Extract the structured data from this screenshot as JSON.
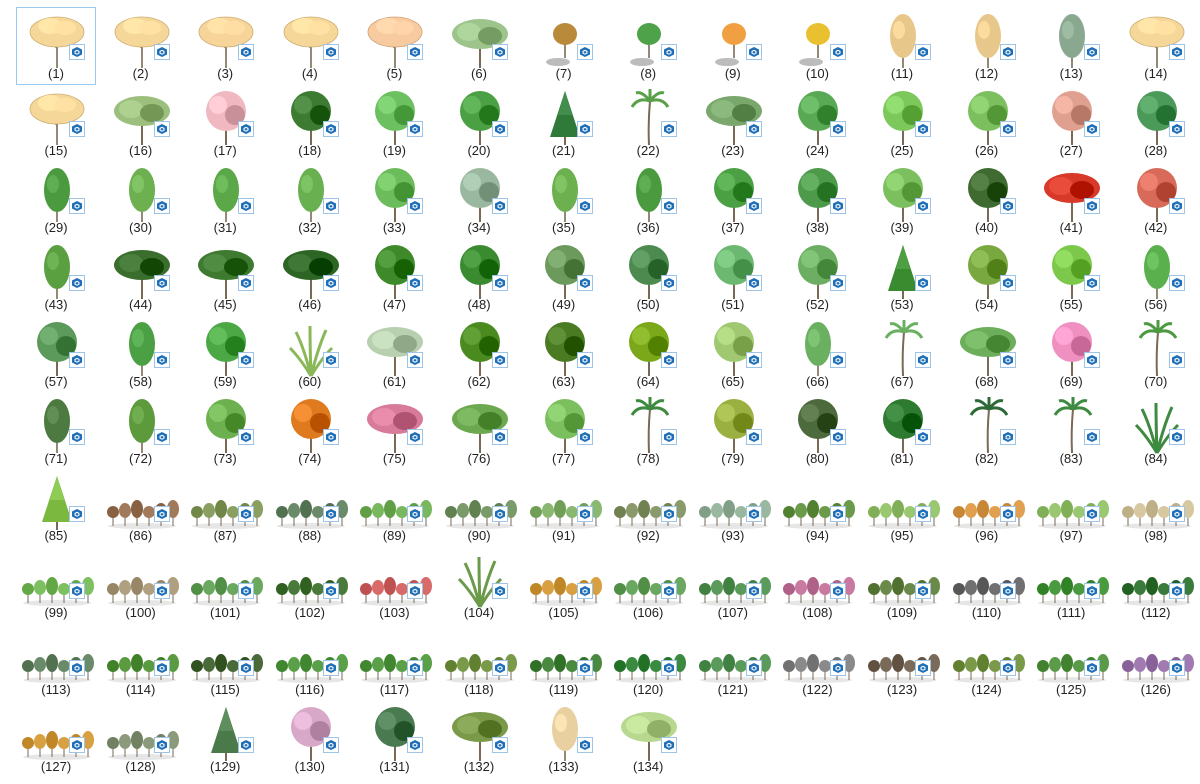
{
  "files": [
    {
      "label": "(1)",
      "icon": "tree-sketch",
      "color": "#f5d79a"
    },
    {
      "label": "(2)",
      "icon": "tree-sketch",
      "color": "#f5d79a"
    },
    {
      "label": "(3)",
      "icon": "tree-sketch",
      "color": "#f6d49a"
    },
    {
      "label": "(4)",
      "icon": "tree-sketch",
      "color": "#f5d79a"
    },
    {
      "label": "(5)",
      "icon": "tree-sketch",
      "color": "#f8caa0"
    },
    {
      "label": "(6)",
      "icon": "tree-broad",
      "color": "#9dc48a"
    },
    {
      "label": "(7)",
      "icon": "tree-small",
      "color": "#b88a3a"
    },
    {
      "label": "(8)",
      "icon": "tree-small",
      "color": "#4ea34a"
    },
    {
      "label": "(9)",
      "icon": "tree-small",
      "color": "#f0a040"
    },
    {
      "label": "(10)",
      "icon": "tree-small",
      "color": "#e8c030"
    },
    {
      "label": "(11)",
      "icon": "tree-tall",
      "color": "#e8c88a"
    },
    {
      "label": "(12)",
      "icon": "tree-tall",
      "color": "#e8c88a"
    },
    {
      "label": "(13)",
      "icon": "tree-tall",
      "color": "#8aa890"
    },
    {
      "label": "(14)",
      "icon": "tree-sketch",
      "color": "#f5d79a"
    },
    {
      "label": "(15)",
      "icon": "tree-sketch",
      "color": "#f5d79a"
    },
    {
      "label": "(16)",
      "icon": "tree-broad",
      "color": "#9cbf7e"
    },
    {
      "label": "(17)",
      "icon": "tree-round",
      "color": "#f0b8c0"
    },
    {
      "label": "(18)",
      "icon": "tree-round",
      "color": "#3d7a32"
    },
    {
      "label": "(19)",
      "icon": "tree-round",
      "color": "#6cc060"
    },
    {
      "label": "(20)",
      "icon": "tree-round",
      "color": "#4ca044"
    },
    {
      "label": "(21)",
      "icon": "tree-conifer",
      "color": "#2f7a38"
    },
    {
      "label": "(22)",
      "icon": "tree-palm",
      "color": "#5aa048"
    },
    {
      "label": "(23)",
      "icon": "tree-broad",
      "color": "#7aa86c"
    },
    {
      "label": "(24)",
      "icon": "tree-round",
      "color": "#58a854"
    },
    {
      "label": "(25)",
      "icon": "tree-round",
      "color": "#7cc85a"
    },
    {
      "label": "(26)",
      "icon": "tree-round",
      "color": "#7cbf5e"
    },
    {
      "label": "(27)",
      "icon": "tree-round",
      "color": "#e0a090"
    },
    {
      "label": "(28)",
      "icon": "tree-round",
      "color": "#4c9a5a"
    },
    {
      "label": "(29)",
      "icon": "tree-tall",
      "color": "#4c9a40"
    },
    {
      "label": "(30)",
      "icon": "tree-tall",
      "color": "#6cb050"
    },
    {
      "label": "(31)",
      "icon": "tree-tall",
      "color": "#5aa848"
    },
    {
      "label": "(32)",
      "icon": "tree-tall",
      "color": "#68b050"
    },
    {
      "label": "(33)",
      "icon": "tree-round",
      "color": "#6cbc5c"
    },
    {
      "label": "(34)",
      "icon": "tree-round",
      "color": "#9ab8a0"
    },
    {
      "label": "(35)",
      "icon": "tree-tall",
      "color": "#6cb050"
    },
    {
      "label": "(36)",
      "icon": "tree-tall",
      "color": "#4c9a40"
    },
    {
      "label": "(37)",
      "icon": "tree-round",
      "color": "#4ca044"
    },
    {
      "label": "(38)",
      "icon": "tree-round",
      "color": "#4c9a4a"
    },
    {
      "label": "(39)",
      "icon": "tree-round",
      "color": "#7cbf5e"
    },
    {
      "label": "(40)",
      "icon": "tree-round",
      "color": "#3f6a30"
    },
    {
      "label": "(41)",
      "icon": "tree-broad",
      "color": "#d83a2a"
    },
    {
      "label": "(42)",
      "icon": "tree-round",
      "color": "#d86a5a"
    },
    {
      "label": "(43)",
      "icon": "tree-tall",
      "color": "#5aa040"
    },
    {
      "label": "(44)",
      "icon": "tree-broad",
      "color": "#3a6e2c"
    },
    {
      "label": "(45)",
      "icon": "tree-broad",
      "color": "#3e7a30"
    },
    {
      "label": "(46)",
      "icon": "tree-broad",
      "color": "#2d6624"
    },
    {
      "label": "(47)",
      "icon": "tree-round",
      "color": "#3e8a2a"
    },
    {
      "label": "(48)",
      "icon": "tree-round",
      "color": "#3a8a30"
    },
    {
      "label": "(49)",
      "icon": "tree-round",
      "color": "#6c9a5c"
    },
    {
      "label": "(50)",
      "icon": "tree-round",
      "color": "#4c8a50"
    },
    {
      "label": "(51)",
      "icon": "tree-round",
      "color": "#6cb870"
    },
    {
      "label": "(52)",
      "icon": "tree-round",
      "color": "#6cae62"
    },
    {
      "label": "(53)",
      "icon": "tree-conifer",
      "color": "#3a8a30"
    },
    {
      "label": "(54)",
      "icon": "tree-round",
      "color": "#7aa840"
    },
    {
      "label": "(55)",
      "icon": "tree-round",
      "color": "#7cc84a"
    },
    {
      "label": "(56)",
      "icon": "tree-tall",
      "color": "#5ab04c"
    },
    {
      "label": "(57)",
      "icon": "tree-round",
      "color": "#5c9a5c"
    },
    {
      "label": "(58)",
      "icon": "tree-tall",
      "color": "#4ca044"
    },
    {
      "label": "(59)",
      "icon": "tree-round",
      "color": "#4ca844"
    },
    {
      "label": "(60)",
      "icon": "tree-grass",
      "color": "#8ab858"
    },
    {
      "label": "(61)",
      "icon": "tree-broad",
      "color": "#b8d0b0"
    },
    {
      "label": "(62)",
      "icon": "tree-round",
      "color": "#4a8a1e"
    },
    {
      "label": "(63)",
      "icon": "tree-round",
      "color": "#4a7a22"
    },
    {
      "label": "(64)",
      "icon": "tree-round",
      "color": "#7aa818"
    },
    {
      "label": "(65)",
      "icon": "tree-round",
      "color": "#a0c870"
    },
    {
      "label": "(66)",
      "icon": "tree-tall",
      "color": "#6ab060"
    },
    {
      "label": "(67)",
      "icon": "tree-palm",
      "color": "#6ab060"
    },
    {
      "label": "(68)",
      "icon": "tree-broad",
      "color": "#6cae5a"
    },
    {
      "label": "(69)",
      "icon": "tree-round",
      "color": "#f090c0"
    },
    {
      "label": "(70)",
      "icon": "tree-palm",
      "color": "#4c9a40"
    },
    {
      "label": "(71)",
      "icon": "tree-tall",
      "color": "#4c7a40"
    },
    {
      "label": "(72)",
      "icon": "tree-tall",
      "color": "#5c9a3c"
    },
    {
      "label": "(73)",
      "icon": "tree-round",
      "color": "#6cb050"
    },
    {
      "label": "(74)",
      "icon": "tree-round",
      "color": "#e07a1e"
    },
    {
      "label": "(75)",
      "icon": "tree-broad",
      "color": "#d87a9a"
    },
    {
      "label": "(76)",
      "icon": "tree-broad",
      "color": "#6ca850"
    },
    {
      "label": "(77)",
      "icon": "tree-round",
      "color": "#7cbf5e"
    },
    {
      "label": "(78)",
      "icon": "tree-palm",
      "color": "#3e8a40"
    },
    {
      "label": "(79)",
      "icon": "tree-round",
      "color": "#9ab040"
    },
    {
      "label": "(80)",
      "icon": "tree-round",
      "color": "#4c6a3c"
    },
    {
      "label": "(81)",
      "icon": "tree-round",
      "color": "#2e7a30"
    },
    {
      "label": "(82)",
      "icon": "tree-palm",
      "color": "#2e6a38"
    },
    {
      "label": "(83)",
      "icon": "tree-palm",
      "color": "#3e8a40"
    },
    {
      "label": "(84)",
      "icon": "tree-grass",
      "color": "#3e8a40"
    },
    {
      "label": "(85)",
      "icon": "tree-conifer",
      "color": "#7ab840"
    },
    {
      "label": "(86)",
      "icon": "tree-row",
      "color": "#a07a5a"
    },
    {
      "label": "(87)",
      "icon": "tree-row",
      "color": "#8aa060"
    },
    {
      "label": "(88)",
      "icon": "tree-row",
      "color": "#6a8a6a"
    },
    {
      "label": "(89)",
      "icon": "tree-row",
      "color": "#7ab860"
    },
    {
      "label": "(90)",
      "icon": "tree-row",
      "color": "#7a9a6a"
    },
    {
      "label": "(91)",
      "icon": "tree-row",
      "color": "#8ab870"
    },
    {
      "label": "(92)",
      "icon": "tree-row",
      "color": "#8a9a6a"
    },
    {
      "label": "(93)",
      "icon": "tree-row",
      "color": "#9ab8a0"
    },
    {
      "label": "(94)",
      "icon": "tree-row",
      "color": "#6a9a4a"
    },
    {
      "label": "(95)",
      "icon": "tree-row",
      "color": "#9ac870"
    },
    {
      "label": "(96)",
      "icon": "tree-row",
      "color": "#e0a050"
    },
    {
      "label": "(97)",
      "icon": "tree-row",
      "color": "#9ac870"
    },
    {
      "label": "(98)",
      "icon": "tree-row",
      "color": "#d8c8a0"
    },
    {
      "label": "(99)",
      "icon": "tree-row",
      "color": "#7cc060"
    },
    {
      "label": "(100)",
      "icon": "tree-row",
      "color": "#b0a080"
    },
    {
      "label": "(101)",
      "icon": "tree-row",
      "color": "#6aa860"
    },
    {
      "label": "(102)",
      "icon": "tree-row",
      "color": "#4a7a3a"
    },
    {
      "label": "(103)",
      "icon": "tree-row",
      "color": "#d86a6a"
    },
    {
      "label": "(104)",
      "icon": "tree-grass",
      "color": "#6a9a4a"
    },
    {
      "label": "(105)",
      "icon": "tree-row",
      "color": "#d8a040"
    },
    {
      "label": "(106)",
      "icon": "tree-row",
      "color": "#6aa860"
    },
    {
      "label": "(107)",
      "icon": "tree-row",
      "color": "#5a9a5a"
    },
    {
      "label": "(108)",
      "icon": "tree-row",
      "color": "#c87aa0"
    },
    {
      "label": "(109)",
      "icon": "tree-row",
      "color": "#6a8a4a"
    },
    {
      "label": "(110)",
      "icon": "tree-row",
      "color": "#707070"
    },
    {
      "label": "(111)",
      "icon": "tree-row",
      "color": "#4a9a40"
    },
    {
      "label": "(112)",
      "icon": "tree-row",
      "color": "#3a7a3a"
    },
    {
      "label": "(113)",
      "icon": "tree-row",
      "color": "#6a8a6a"
    },
    {
      "label": "(114)",
      "icon": "tree-row",
      "color": "#5a9a40"
    },
    {
      "label": "(115)",
      "icon": "tree-row",
      "color": "#4a6a3a"
    },
    {
      "label": "(116)",
      "icon": "tree-row",
      "color": "#5aa048"
    },
    {
      "label": "(117)",
      "icon": "tree-row",
      "color": "#5aa048"
    },
    {
      "label": "(118)",
      "icon": "tree-row",
      "color": "#7a9a4a"
    },
    {
      "label": "(119)",
      "icon": "tree-row",
      "color": "#4a8a40"
    },
    {
      "label": "(120)",
      "icon": "tree-row",
      "color": "#3a8a40"
    },
    {
      "label": "(121)",
      "icon": "tree-row",
      "color": "#5a9a5a"
    },
    {
      "label": "(122)",
      "icon": "tree-row",
      "color": "#8a8a8a"
    },
    {
      "label": "(123)",
      "icon": "tree-row",
      "color": "#7a6a5a"
    },
    {
      "label": "(124)",
      "icon": "tree-row",
      "color": "#7a9a4a"
    },
    {
      "label": "(125)",
      "icon": "tree-row",
      "color": "#5a9a48"
    },
    {
      "label": "(126)",
      "icon": "tree-row",
      "color": "#a07ab0"
    },
    {
      "label": "(127)",
      "icon": "tree-row",
      "color": "#d8a040"
    },
    {
      "label": "(128)",
      "icon": "tree-row",
      "color": "#8a9a7a"
    },
    {
      "label": "(129)",
      "icon": "tree-conifer",
      "color": "#4a7a4a"
    },
    {
      "label": "(130)",
      "icon": "tree-round",
      "color": "#d8a8c8"
    },
    {
      "label": "(131)",
      "icon": "tree-round",
      "color": "#4a7a50"
    },
    {
      "label": "(132)",
      "icon": "tree-broad",
      "color": "#7a9a4a"
    },
    {
      "label": "(133)",
      "icon": "tree-tall",
      "color": "#e8d0a0"
    },
    {
      "label": "(134)",
      "icon": "tree-broad",
      "color": "#b8d890"
    }
  ],
  "selected_index": 0,
  "badge": {
    "icon": "sketchup-icon",
    "color": "#1e6fb8"
  }
}
